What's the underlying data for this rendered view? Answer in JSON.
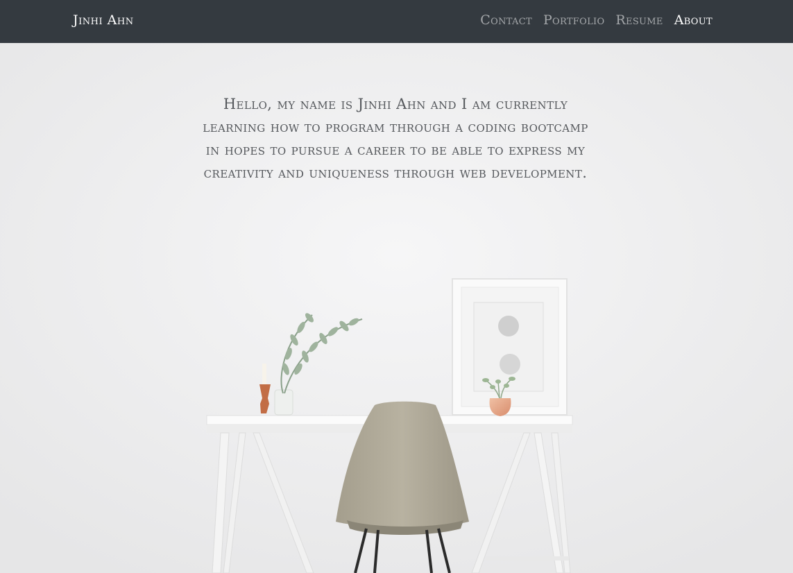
{
  "navbar": {
    "brand": "Jinhi Ahn",
    "links": [
      {
        "label": "Contact",
        "active": false
      },
      {
        "label": "Portfolio",
        "active": false
      },
      {
        "label": "Resume",
        "active": false
      },
      {
        "label": "About",
        "active": true
      }
    ]
  },
  "hero": {
    "intro": "Hello, my name is Jinhi Ahn and I am currently learning how to program through a coding bootcamp in hopes to pursue a career to be able to express my creativity and uniqueness through web development."
  },
  "colors": {
    "navbar_bg": "#343a40",
    "nav_active": "#ffffff",
    "nav_inactive": "#a7a9ab",
    "intro_text": "#55585c"
  }
}
